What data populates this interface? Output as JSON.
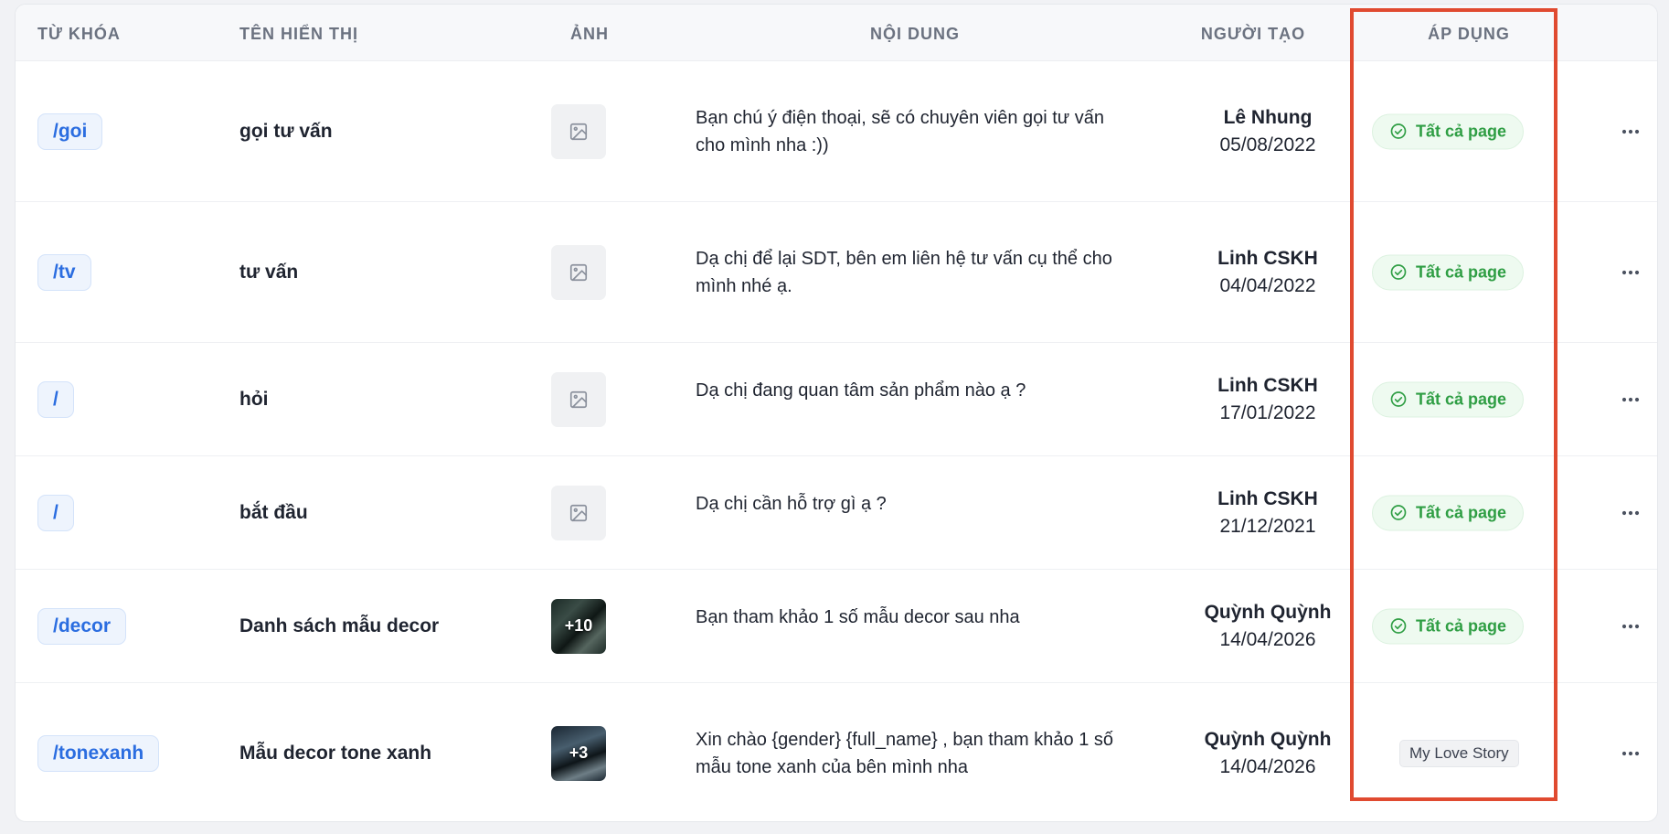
{
  "columns": {
    "keyword": "TỪ KHÓA",
    "display_name": "TÊN HIỂN THỊ",
    "image": "ẢNH",
    "content": "NỘI DUNG",
    "creator": "NGƯỜI TẠO",
    "apply": "ÁP DỤNG"
  },
  "rows": [
    {
      "keyword": "/goi",
      "name": "gọi tư vấn",
      "image_count": "",
      "content": "Bạn chú ý điện thoại, sẽ có chuyên viên gọi tư vấn cho mình nha :))",
      "creator": "Lê Nhung",
      "date": "05/08/2022",
      "apply": "Tất cả page"
    },
    {
      "keyword": "/tv",
      "name": "tư vấn",
      "image_count": "",
      "content": "Dạ chị để lại SDT, bên em liên hệ tư vấn cụ thể cho mình nhé ạ.",
      "creator": "Linh CSKH",
      "date": "04/04/2022",
      "apply": "Tất cả page"
    },
    {
      "keyword": "/",
      "name": "hỏi",
      "image_count": "",
      "content": "Dạ chị đang quan tâm sản phẩm nào ạ ?",
      "creator": "Linh CSKH",
      "date": "17/01/2022",
      "apply": "Tất cả page"
    },
    {
      "keyword": "/",
      "name": "bắt đầu",
      "image_count": "",
      "content": "Dạ chị cần hỗ trợ gì ạ ?",
      "creator": "Linh CSKH",
      "date": "21/12/2021",
      "apply": "Tất cả page"
    },
    {
      "keyword": "/decor",
      "name": "Danh sách mẫu decor",
      "image_count": "+10",
      "content": "Bạn tham khảo 1 số mẫu decor sau nha",
      "creator": "Quỳnh Quỳnh",
      "date": "14/04/2026",
      "apply": "Tất cả page"
    },
    {
      "keyword": "/tonexanh",
      "name": "Mẫu decor tone xanh",
      "image_count": "+3",
      "content": "Xin chào {gender} {full_name} , bạn tham khảo 1 số mẫu tone xanh của bên mình nha",
      "creator": "Quỳnh Quỳnh",
      "date": "14/04/2026",
      "apply_tag": "My Love Story"
    }
  ],
  "colors": {
    "keyword": "#2b6de0",
    "apply_green": "#2f9e44",
    "highlight": "#e04a30"
  },
  "icons": {
    "image_placeholder": "image-placeholder-icon",
    "apply": "check-circle-icon",
    "more": "more-horizontal-icon"
  }
}
